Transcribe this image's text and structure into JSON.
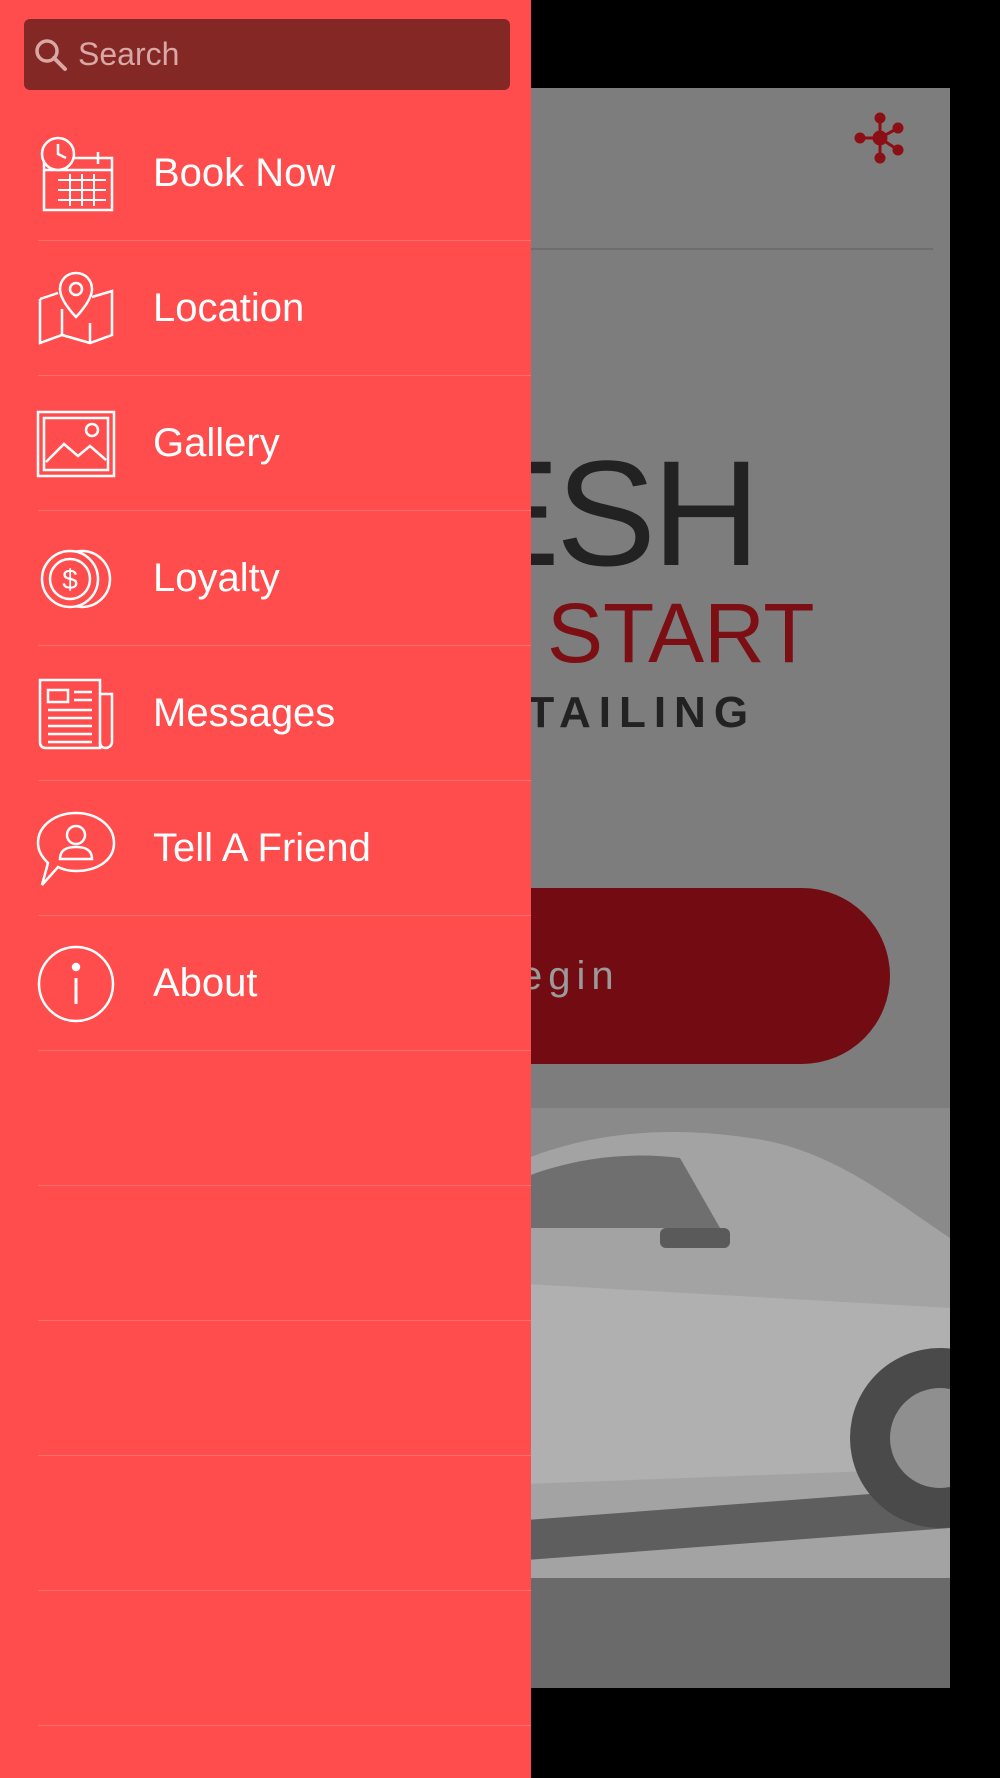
{
  "background_app": {
    "logo_line1": "ESH",
    "logo_line2": "START",
    "logo_line3": "ETAILING",
    "begin_label": "egin",
    "share_icon": "share-network-icon"
  },
  "drawer": {
    "search": {
      "placeholder": "Search",
      "value": ""
    },
    "items": [
      {
        "label": "Book Now",
        "icon": "calendar-clock-icon"
      },
      {
        "label": "Location",
        "icon": "map-pin-icon"
      },
      {
        "label": "Gallery",
        "icon": "image-icon"
      },
      {
        "label": "Loyalty",
        "icon": "coins-icon"
      },
      {
        "label": "Messages",
        "icon": "newspaper-icon"
      },
      {
        "label": "Tell A Friend",
        "icon": "chat-person-icon"
      },
      {
        "label": "About",
        "icon": "info-icon"
      }
    ]
  },
  "colors": {
    "drawer_bg": "#ff4d4d",
    "search_bg": "#842826",
    "accent_dark": "#730c12"
  }
}
